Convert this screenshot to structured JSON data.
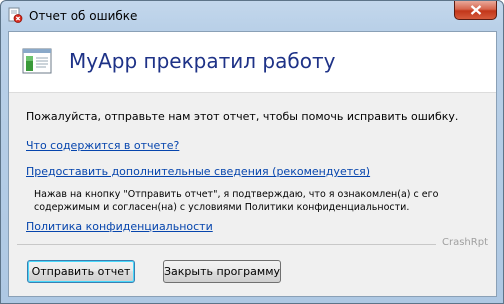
{
  "window": {
    "title": "Отчет об ошибке"
  },
  "header": {
    "title": "MyApp прекратил работу"
  },
  "body": {
    "message": "Пожалуйста, отправьте нам этот отчет, чтобы помочь исправить ошибку.",
    "link_contents": "Что содержится в отчете?",
    "link_details": "Предоставить дополнительные сведения (рекомендуется)",
    "consent": "Нажав на кнопку \"Отправить отчет\", я подтверждаю, что я ознакомлен(а) с его содержимым и согласен(на) с условиями Политики конфиденциальности.",
    "link_privacy": "Политика конфиденциальности"
  },
  "footer": {
    "brand": "CrashRpt",
    "send_label": "Отправить отчет",
    "close_label": "Закрыть программу"
  },
  "icons": {
    "title_icon": "error-report-icon",
    "app_icon": "application-window-icon",
    "close_icon": "close-icon"
  }
}
